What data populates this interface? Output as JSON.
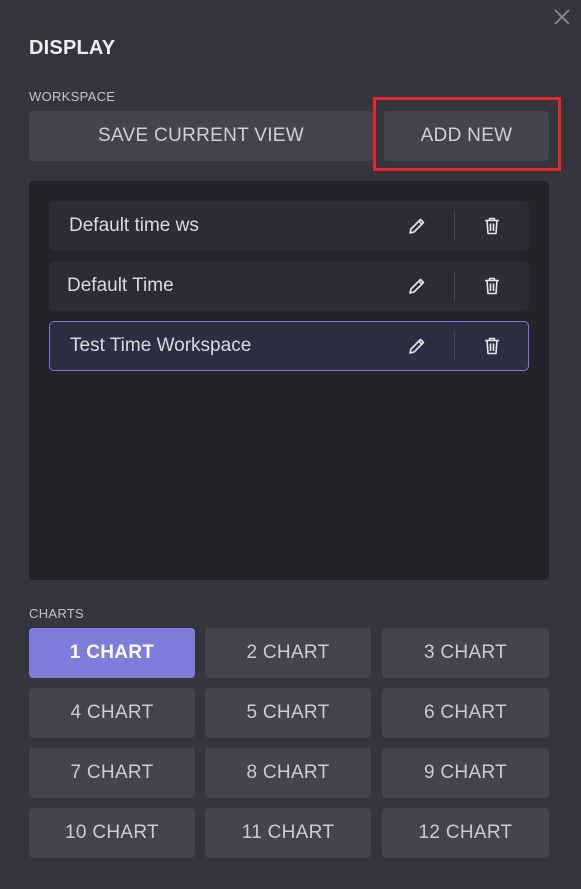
{
  "dialog": {
    "title": "DISPLAY",
    "close_icon": "close-icon"
  },
  "workspace": {
    "section_label": "WORKSPACE",
    "save_label": "SAVE CURRENT VIEW",
    "add_label": "ADD NEW",
    "items": [
      {
        "name": "Default time ws",
        "selected": false
      },
      {
        "name": "Default Time",
        "selected": false
      },
      {
        "name": "Test Time Workspace",
        "selected": true
      }
    ],
    "edit_icon": "pencil-icon",
    "delete_icon": "trash-icon"
  },
  "charts": {
    "section_label": "CHARTS",
    "options": [
      {
        "label": "1 CHART",
        "active": true
      },
      {
        "label": "2 CHART",
        "active": false
      },
      {
        "label": "3 CHART",
        "active": false
      },
      {
        "label": "4 CHART",
        "active": false
      },
      {
        "label": "5 CHART",
        "active": false
      },
      {
        "label": "6 CHART",
        "active": false
      },
      {
        "label": "7 CHART",
        "active": false
      },
      {
        "label": "8 CHART",
        "active": false
      },
      {
        "label": "9 CHART",
        "active": false
      },
      {
        "label": "10 CHART",
        "active": false
      },
      {
        "label": "11 CHART",
        "active": false
      },
      {
        "label": "12 CHART",
        "active": false
      }
    ]
  },
  "colors": {
    "background": "#35353e",
    "panel": "#232329",
    "button": "#44444e",
    "accent": "#7f7ddb",
    "highlight": "#e8252d"
  }
}
